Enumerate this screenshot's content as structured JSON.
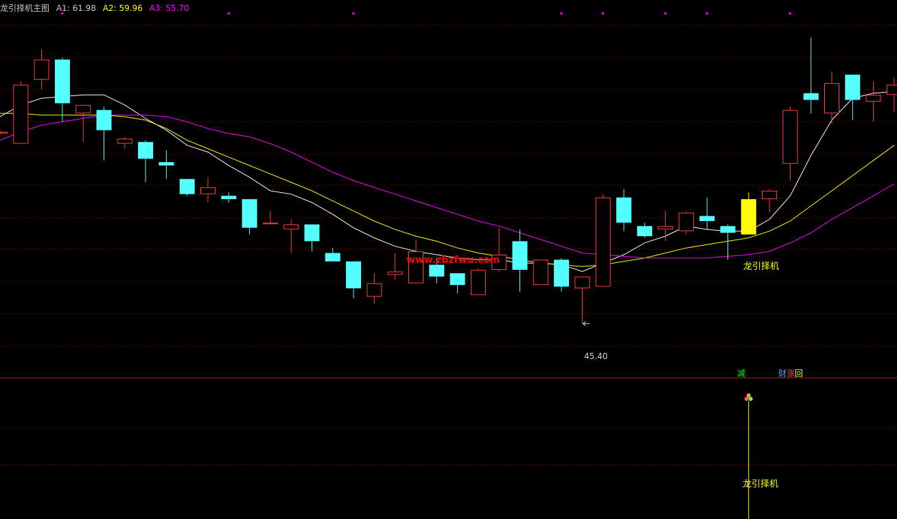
{
  "header": {
    "title": "龙引择机主图",
    "a1_label": "A1:",
    "a1_value": "61.98",
    "a2_label": "A2:",
    "a2_value": "59.96",
    "a3_label": "A3:",
    "a3_value": "55.70"
  },
  "colors": {
    "background": "#000000",
    "grid": "#7a0000",
    "separator": "#b01818",
    "up_candle": "#ff4040",
    "down_candle": "#54ffff",
    "signal_candle": "#ffff00",
    "a1_line": "#ffffff",
    "a2_line": "#ffff00",
    "a3_line": "#ff00ff",
    "watermark": "#ff0000",
    "signal_text": "#ffff00"
  },
  "annotations": {
    "low_label": "45.40",
    "watermark": "www.zbzfwu.com",
    "signal_main": "龙引择机",
    "signal_sub": "龙引择机",
    "tag_green": "减",
    "tag_blue": "财",
    "tag_red": "涨",
    "tag_yellow": "回"
  },
  "chart_data": {
    "type": "candlestick",
    "title": "龙引择机主图",
    "y_range": [
      43.5,
      63.7
    ],
    "grid": true,
    "low_marker": 45.4,
    "candles": [
      {
        "o": 56.7,
        "h": 56.9,
        "l": 56.6,
        "c": 56.8
      },
      {
        "o": 56.1,
        "h": 59.8,
        "l": 56.1,
        "c": 59.6
      },
      {
        "o": 59.9,
        "h": 61.7,
        "l": 59.3,
        "c": 61.1
      },
      {
        "o": 61.1,
        "h": 61.2,
        "l": 57.4,
        "c": 58.5
      },
      {
        "o": 57.9,
        "h": 58.1,
        "l": 56.2,
        "c": 58.4
      },
      {
        "o": 58.1,
        "h": 58.3,
        "l": 55.1,
        "c": 56.9
      },
      {
        "o": 56.1,
        "h": 56.5,
        "l": 55.8,
        "c": 56.4
      },
      {
        "o": 56.2,
        "h": 56.3,
        "l": 53.8,
        "c": 55.2
      },
      {
        "o": 55.0,
        "h": 55.7,
        "l": 54.0,
        "c": 54.8
      },
      {
        "o": 54.0,
        "h": 54.0,
        "l": 53.0,
        "c": 53.1
      },
      {
        "o": 53.1,
        "h": 54.1,
        "l": 52.6,
        "c": 53.5
      },
      {
        "o": 53.0,
        "h": 53.2,
        "l": 52.6,
        "c": 52.8
      },
      {
        "o": 52.8,
        "h": 52.8,
        "l": 50.7,
        "c": 51.1
      },
      {
        "o": 51.4,
        "h": 52.1,
        "l": 51.3,
        "c": 51.4
      },
      {
        "o": 51.0,
        "h": 51.6,
        "l": 49.6,
        "c": 51.3
      },
      {
        "o": 51.3,
        "h": 51.3,
        "l": 49.7,
        "c": 50.3
      },
      {
        "o": 49.6,
        "h": 49.9,
        "l": 49.1,
        "c": 49.1
      },
      {
        "o": 49.1,
        "h": 49.1,
        "l": 46.9,
        "c": 47.5
      },
      {
        "o": 47.0,
        "h": 48.4,
        "l": 46.6,
        "c": 47.8
      },
      {
        "o": 48.3,
        "h": 49.6,
        "l": 48.0,
        "c": 48.5
      },
      {
        "o": 47.8,
        "h": 50.4,
        "l": 47.8,
        "c": 49.7
      },
      {
        "o": 48.9,
        "h": 49.3,
        "l": 47.8,
        "c": 48.2
      },
      {
        "o": 48.4,
        "h": 48.4,
        "l": 47.2,
        "c": 47.7
      },
      {
        "o": 47.1,
        "h": 48.7,
        "l": 47.1,
        "c": 48.6
      },
      {
        "o": 48.6,
        "h": 51.1,
        "l": 48.5,
        "c": 49.5
      },
      {
        "o": 50.3,
        "h": 51.0,
        "l": 47.3,
        "c": 48.6
      },
      {
        "o": 47.7,
        "h": 49.2,
        "l": 47.7,
        "c": 49.2
      },
      {
        "o": 49.2,
        "h": 49.3,
        "l": 47.3,
        "c": 47.6
      },
      {
        "o": 47.5,
        "h": 48.0,
        "l": 45.4,
        "c": 48.2
      },
      {
        "o": 47.6,
        "h": 53.1,
        "l": 47.6,
        "c": 52.9
      },
      {
        "o": 52.9,
        "h": 53.4,
        "l": 50.9,
        "c": 51.4
      },
      {
        "o": 51.2,
        "h": 51.4,
        "l": 50.5,
        "c": 50.6
      },
      {
        "o": 51.0,
        "h": 52.1,
        "l": 50.3,
        "c": 51.2
      },
      {
        "o": 50.9,
        "h": 52.1,
        "l": 50.7,
        "c": 52.0
      },
      {
        "o": 51.8,
        "h": 52.9,
        "l": 51.0,
        "c": 51.5
      },
      {
        "o": 51.2,
        "h": 51.3,
        "l": 49.2,
        "c": 50.8
      },
      {
        "o": 50.7,
        "h": 53.2,
        "l": 50.7,
        "c": 52.8,
        "signal": true
      },
      {
        "o": 52.8,
        "h": 53.4,
        "l": 52.0,
        "c": 53.3
      },
      {
        "o": 54.9,
        "h": 58.3,
        "l": 53.9,
        "c": 58.1
      },
      {
        "o": 59.1,
        "h": 62.4,
        "l": 57.9,
        "c": 58.7
      },
      {
        "o": 57.9,
        "h": 60.4,
        "l": 57.3,
        "c": 59.7
      },
      {
        "o": 60.2,
        "h": 60.2,
        "l": 57.5,
        "c": 58.7
      },
      {
        "o": 58.6,
        "h": 59.8,
        "l": 57.4,
        "c": 59.0
      },
      {
        "o": 59.0,
        "h": 60.0,
        "l": 58.0,
        "c": 59.6
      }
    ],
    "series": [
      {
        "name": "A1",
        "values": [
          57.7,
          58.4,
          58.8,
          58.9,
          59.0,
          59.0,
          58.4,
          57.6,
          56.9,
          56.0,
          55.6,
          54.8,
          54.1,
          53.3,
          53.1,
          52.6,
          51.9,
          51.1,
          50.5,
          50.0,
          49.7,
          49.5,
          49.3,
          49.2,
          49.2,
          49.0,
          49.0,
          48.9,
          48.5,
          49.0,
          49.5,
          50.2,
          50.6,
          51.2,
          51.0,
          50.9,
          50.9,
          51.6,
          53.0,
          55.4,
          57.5,
          58.8,
          59.1,
          59.2
        ]
      },
      {
        "name": "A2",
        "values": [
          57.9,
          57.9,
          57.8,
          57.8,
          57.8,
          57.8,
          57.7,
          57.5,
          57.0,
          56.3,
          55.8,
          55.3,
          54.8,
          54.3,
          53.8,
          53.3,
          52.7,
          52.1,
          51.5,
          51.0,
          50.6,
          50.3,
          49.9,
          49.6,
          49.4,
          49.2,
          49.0,
          48.9,
          48.8,
          48.9,
          49.1,
          49.3,
          49.6,
          49.9,
          50.1,
          50.3,
          50.5,
          50.9,
          51.5,
          52.4,
          53.3,
          54.2,
          55.1,
          56.0
        ]
      },
      {
        "name": "A3",
        "values": [
          56.3,
          56.8,
          57.2,
          57.4,
          57.6,
          57.8,
          57.8,
          57.8,
          57.7,
          57.4,
          57.0,
          56.7,
          56.5,
          56.1,
          55.6,
          55.0,
          54.4,
          53.9,
          53.5,
          53.1,
          52.7,
          52.3,
          51.9,
          51.5,
          51.2,
          50.8,
          50.4,
          50.0,
          49.6,
          49.5,
          49.4,
          49.3,
          49.3,
          49.3,
          49.3,
          49.4,
          49.5,
          49.7,
          50.2,
          50.8,
          51.6,
          52.3,
          53.0,
          53.7
        ]
      }
    ],
    "signal_index": 36,
    "top_markers": [
      3,
      11,
      17,
      27,
      29,
      32,
      34,
      38
    ]
  }
}
